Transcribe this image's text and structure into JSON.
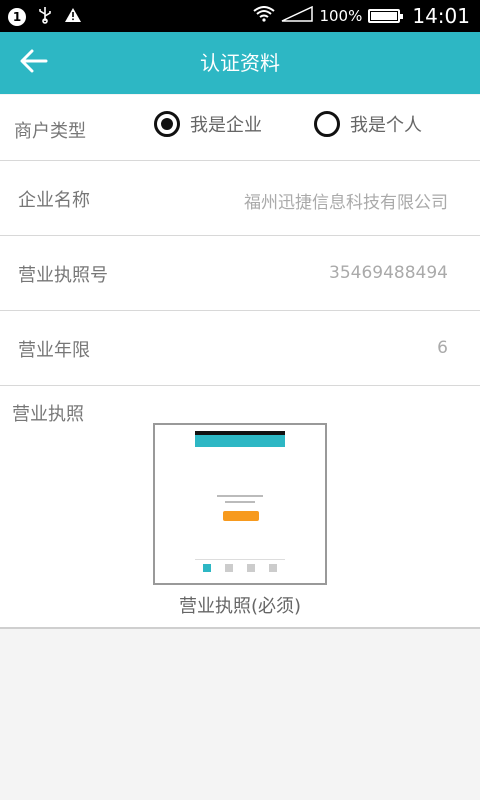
{
  "status_bar": {
    "notification_count": "1",
    "battery_text": "100%",
    "battery_level": 1.0,
    "time": "14:01",
    "icons": [
      "usb-icon",
      "warning-icon",
      "wifi-icon",
      "signal-icon",
      "battery-icon"
    ]
  },
  "header": {
    "title": "认证资料",
    "back_icon": "arrow-left-icon",
    "background_color": "#2db7c4"
  },
  "merchant_type": {
    "label": "商户类型",
    "options": [
      {
        "label": "我是企业",
        "selected": true
      },
      {
        "label": "我是个人",
        "selected": false
      }
    ]
  },
  "fields": {
    "company_name": {
      "label": "企业名称",
      "value": "福州迅捷信息科技有限公司"
    },
    "license_number": {
      "label": "营业执照号",
      "value": "35469488494"
    },
    "business_years": {
      "label": "营业年限",
      "value": "6"
    }
  },
  "license_photo": {
    "label": "营业执照",
    "caption": "营业执照(必须)"
  }
}
